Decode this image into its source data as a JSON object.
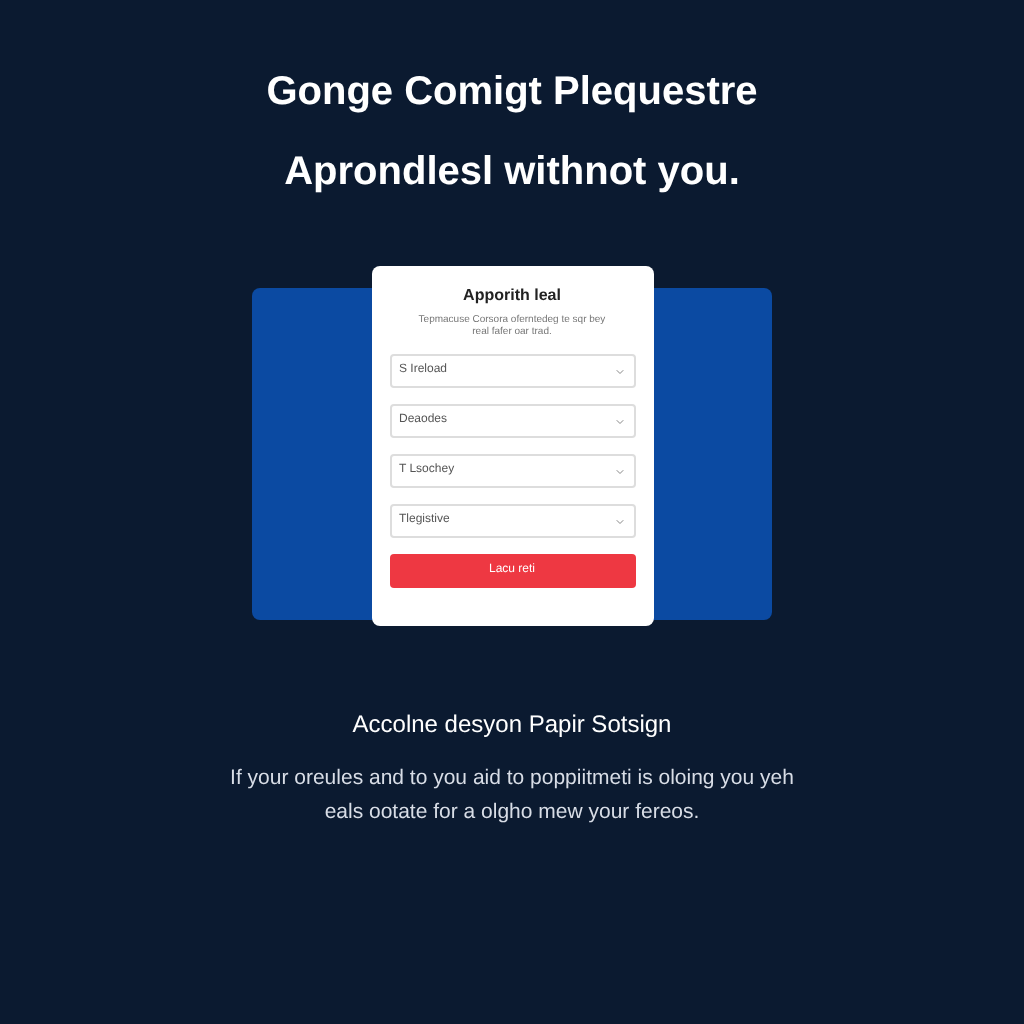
{
  "headline": [
    "Gonge Comigt Plequestre",
    "Aprondlesl withnot you."
  ],
  "card": {
    "title": "Apporith leal",
    "description": "Tepmacuse Corsora oferntedeg te sqr bey real fafer oar trad.",
    "selects": [
      {
        "value": "S Ireload"
      },
      {
        "value": "Deaodes"
      },
      {
        "value": "T Lsochey"
      },
      {
        "value": "Tlegistive"
      }
    ],
    "button": "Lacu reti"
  },
  "section_title": "Accolne desyon Papir Sotsign",
  "paragraph": "If your oreules and to you aid to poppiitmeti is oloing you yeh eals ootate for a olgho mew your fereos."
}
